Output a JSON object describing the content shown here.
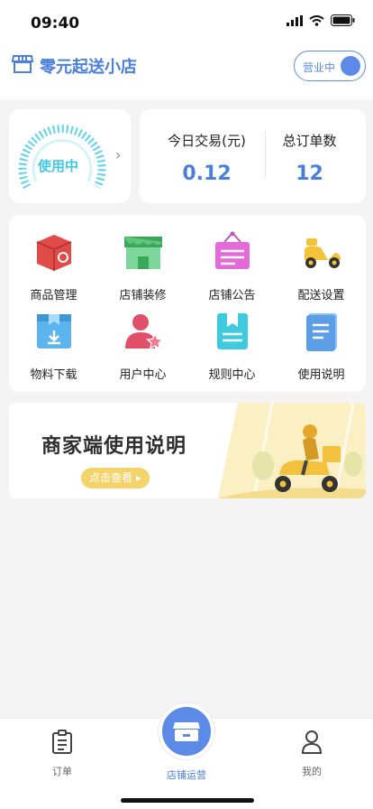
{
  "status_bar": {
    "time": "09:40"
  },
  "header": {
    "store_name": "零元起送小店",
    "open_toggle_label": "营业中"
  },
  "status_card": {
    "label": "使用中"
  },
  "stats": {
    "today_trade_label": "今日交易(元)",
    "today_trade_value": "0.12",
    "total_orders_label": "总订单数",
    "total_orders_value": "12"
  },
  "menu": [
    {
      "label": "商品管理",
      "icon": "product-box-icon"
    },
    {
      "label": "店铺装修",
      "icon": "storefront-icon"
    },
    {
      "label": "店铺公告",
      "icon": "notice-board-icon"
    },
    {
      "label": "配送设置",
      "icon": "scooter-icon"
    },
    {
      "label": "物料下载",
      "icon": "download-box-icon"
    },
    {
      "label": "用户中心",
      "icon": "user-star-icon"
    },
    {
      "label": "规则中心",
      "icon": "bookmark-doc-icon"
    },
    {
      "label": "使用说明",
      "icon": "manual-book-icon"
    }
  ],
  "banner": {
    "title": "商家端使用说明",
    "button_label": "点击查看"
  },
  "tabbar": {
    "orders_label": "订单",
    "store_ops_label": "店铺运营",
    "mine_label": "我的"
  },
  "colors": {
    "accent": "#4a7fdc",
    "gauge": "#3fc7e6",
    "banner_button": "#f3d36a"
  }
}
